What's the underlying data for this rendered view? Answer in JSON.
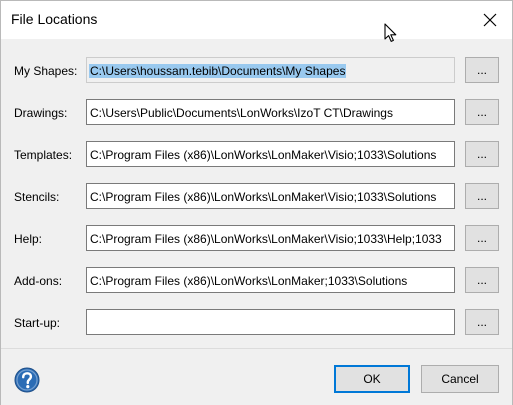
{
  "dialog": {
    "title": "File Locations",
    "close_icon": "close-icon",
    "accent_color": "#0078d7",
    "selection_color": "#99c9ef"
  },
  "rows": [
    {
      "label": "My Shapes:",
      "value": "C:\\Users\\houssam.tebib\\Documents\\My Shapes",
      "browse_label": "...",
      "selected": true,
      "disabled": true
    },
    {
      "label": "Drawings:",
      "value": "C:\\Users\\Public\\Documents\\LonWorks\\IzoT CT\\Drawings",
      "browse_label": "..."
    },
    {
      "label": "Templates:",
      "value": "C:\\Program Files (x86)\\LonWorks\\LonMaker\\Visio;1033\\Solutions",
      "browse_label": "..."
    },
    {
      "label": "Stencils:",
      "value": "C:\\Program Files (x86)\\LonWorks\\LonMaker\\Visio;1033\\Solutions",
      "browse_label": "..."
    },
    {
      "label": "Help:",
      "value": "C:\\Program Files (x86)\\LonWorks\\LonMaker\\Visio;1033\\Help;1033",
      "browse_label": "..."
    },
    {
      "label": "Add-ons:",
      "value": "C:\\Program Files (x86)\\LonWorks\\LonMaker;1033\\Solutions",
      "browse_label": "..."
    },
    {
      "label": "Start-up:",
      "value": "",
      "browse_label": "..."
    }
  ],
  "footer": {
    "help_icon": "help-icon",
    "ok_label": "OK",
    "cancel_label": "Cancel"
  }
}
